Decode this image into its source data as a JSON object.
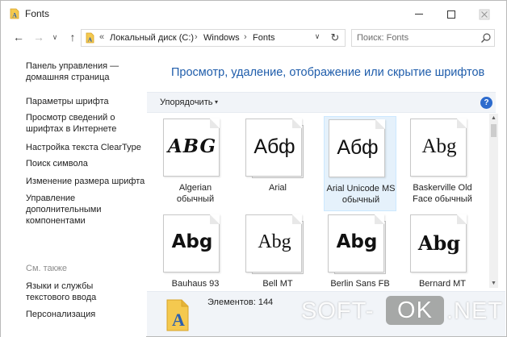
{
  "window": {
    "title": "Fonts",
    "colors": {
      "accent": "#1f5dab",
      "toolbar_bg": "#f1f4f8",
      "selection_bg": "#e5f1fb",
      "help": "#2d6bcd"
    },
    "icons": [
      "fonts-folder-icon",
      "minimize-icon",
      "maximize-icon",
      "close-icon"
    ]
  },
  "address": {
    "back_icon": "←",
    "forward_icon": "→",
    "recent_icon": "∨",
    "up_icon": "↑",
    "overflow": "«",
    "crumbs": [
      "Локальный диск (C:)",
      "Windows",
      "Fonts"
    ],
    "separator": "›",
    "dropdown_icon": "∨",
    "refresh_icon": "↻",
    "search_placeholder": "Поиск: Fonts"
  },
  "sidebar": {
    "home_link": "Панель управления —\nдомашняя страница",
    "links": [
      "Параметры шрифта",
      "Просмотр сведений о шрифтах в Интернете",
      "Настройка текста ClearType",
      "Поиск символа",
      "Изменение размера шрифта",
      "Управление дополнительными компонентами"
    ],
    "see_also_heading": "См. также",
    "see_also": [
      "Языки и службы текстового ввода",
      "Персонализация"
    ]
  },
  "main": {
    "title": "Просмотр, удаление, отображение или скрытие шрифтов",
    "organize_label": "Упорядочить",
    "organize_arrow": "▾",
    "help_label": "?",
    "fonts": [
      {
        "sample": "ABG",
        "name": "Algerian\nобычный",
        "family_style": "algerian",
        "selected": false,
        "stacked": false
      },
      {
        "sample": "Абф",
        "name": "Arial",
        "family_style": "arial",
        "selected": false,
        "stacked": true
      },
      {
        "sample": "Абф",
        "name": "Arial Unicode MS\nобычный",
        "family_style": "arial",
        "selected": true,
        "stacked": false
      },
      {
        "sample": "Abg",
        "name": "Baskerville Old\nFace обычный",
        "family_style": "baskerville",
        "selected": false,
        "stacked": false
      },
      {
        "sample": "Abg",
        "name": "Bauhaus 93",
        "family_style": "bauhaus",
        "selected": false,
        "stacked": false
      },
      {
        "sample": "Abg",
        "name": "Bell MT",
        "family_style": "bell",
        "selected": false,
        "stacked": true
      },
      {
        "sample": "Abg",
        "name": "Berlin Sans FB",
        "family_style": "berlin",
        "selected": false,
        "stacked": true
      },
      {
        "sample": "Abg",
        "name": "Bernard MT",
        "family_style": "bernard",
        "selected": false,
        "stacked": false
      }
    ],
    "scroll_up": "▲",
    "scroll_down": "▼"
  },
  "details": {
    "count_text": "Элементов: 144"
  },
  "watermark": {
    "left": "SOFT-",
    "ok": "OK",
    "right": ".NET"
  }
}
